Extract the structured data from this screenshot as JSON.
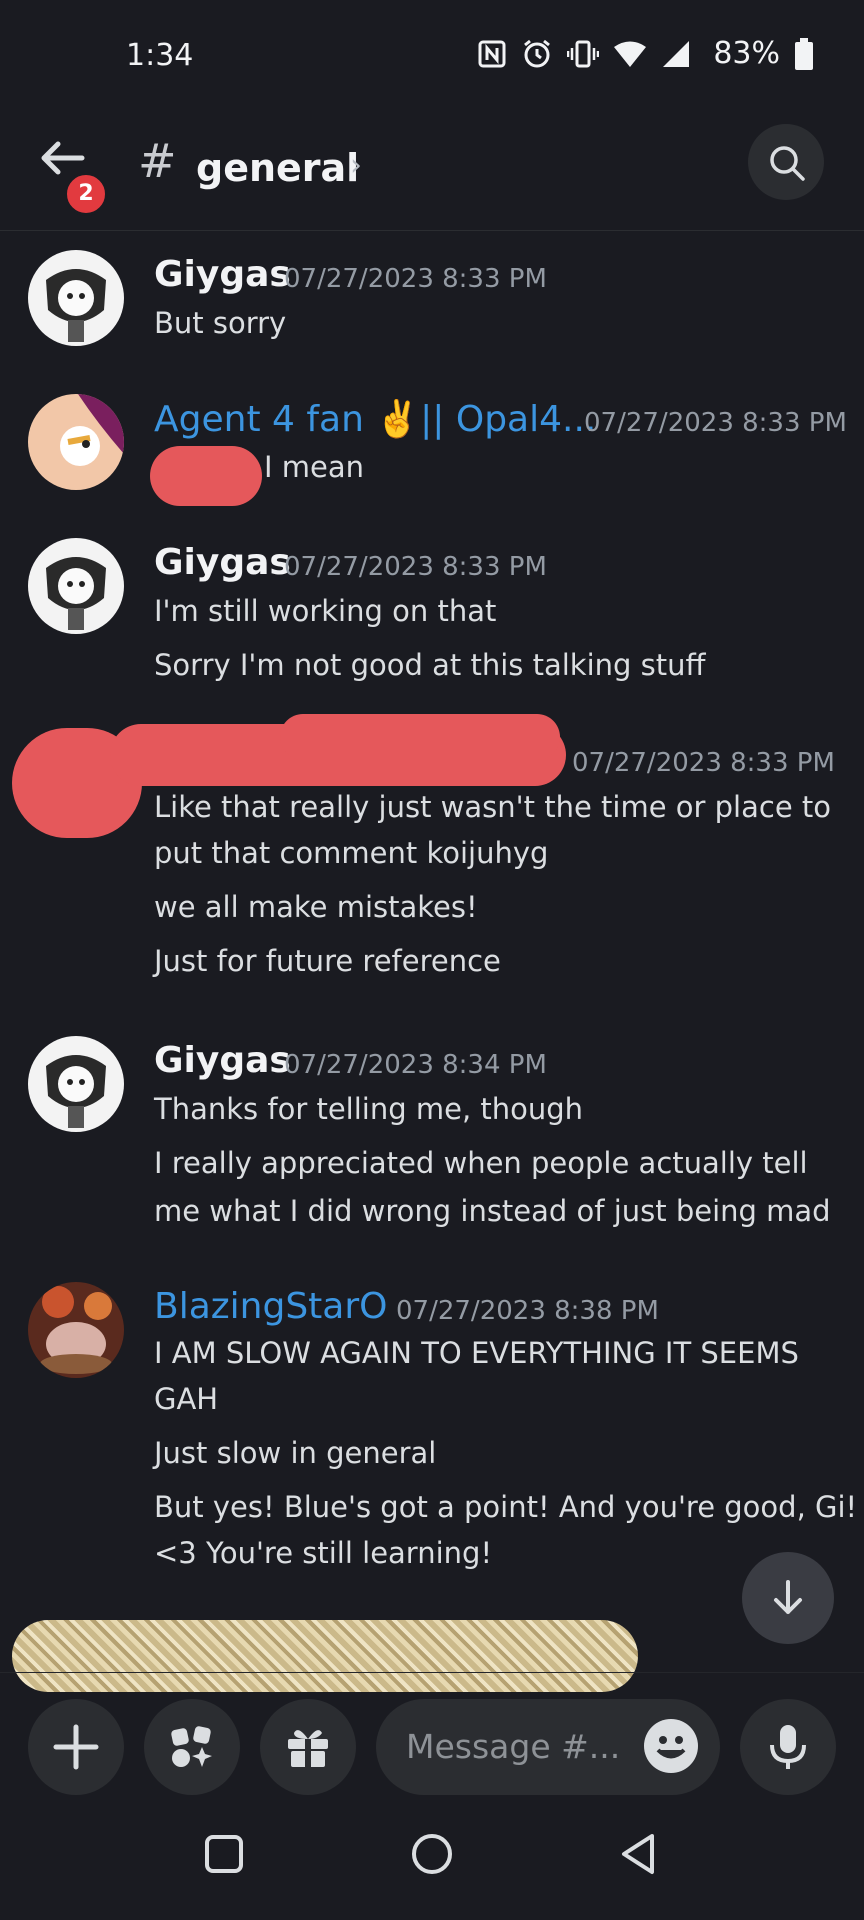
{
  "status_bar": {
    "time": "1:34",
    "battery": "83%"
  },
  "header": {
    "channel_hash": "#",
    "channel_name": "general",
    "chevron": "›",
    "unread_badge": "2"
  },
  "messages": [
    {
      "author": "Giygas",
      "timestamp": "07/27/2023 8:33 PM",
      "lines": [
        "But sorry"
      ]
    },
    {
      "author": "Agent 4 fan ✌️|| Opal4...",
      "timestamp": "07/27/2023 8:33 PM",
      "lines": [
        "I mean"
      ],
      "author_color": "#3c95e0"
    },
    {
      "author": "Giygas",
      "timestamp": "07/27/2023 8:33 PM",
      "lines": [
        "I'm still working on that",
        "Sorry I'm not good at this talking stuff"
      ]
    },
    {
      "author": "",
      "timestamp": "07/27/2023 8:33 PM",
      "lines": [
        "Like that really just wasn't the time or place to",
        "put that comment koijuhyg",
        "we all make mistakes!",
        "Just for future reference"
      ]
    },
    {
      "author": "Giygas",
      "timestamp": "07/27/2023 8:34 PM",
      "lines": [
        "Thanks for telling me, though",
        "I really appreciated when people actually tell",
        "me what I did wrong instead of just being mad"
      ]
    },
    {
      "author": "BlazingStarO",
      "timestamp": "07/27/2023 8:38 PM",
      "lines": [
        "I AM SLOW AGAIN TO EVERYTHING IT SEEMS",
        "GAH",
        "Just slow in general",
        "But yes! Blue's got a point! And you're good, Gi!",
        "<3 You're still learning!"
      ],
      "author_color": "#3c95e0"
    }
  ],
  "composer": {
    "placeholder": "Message #..."
  },
  "icons": [
    "back-arrow-icon",
    "search-icon",
    "arrow-down-icon",
    "plus-icon",
    "apps-icon",
    "gift-icon",
    "emoji-icon",
    "mic-icon"
  ],
  "colors": {
    "background": "#1a1b21",
    "link_blue": "#3c95e0",
    "badge_red": "#e23a3f",
    "redaction_red": "#e5585b"
  }
}
